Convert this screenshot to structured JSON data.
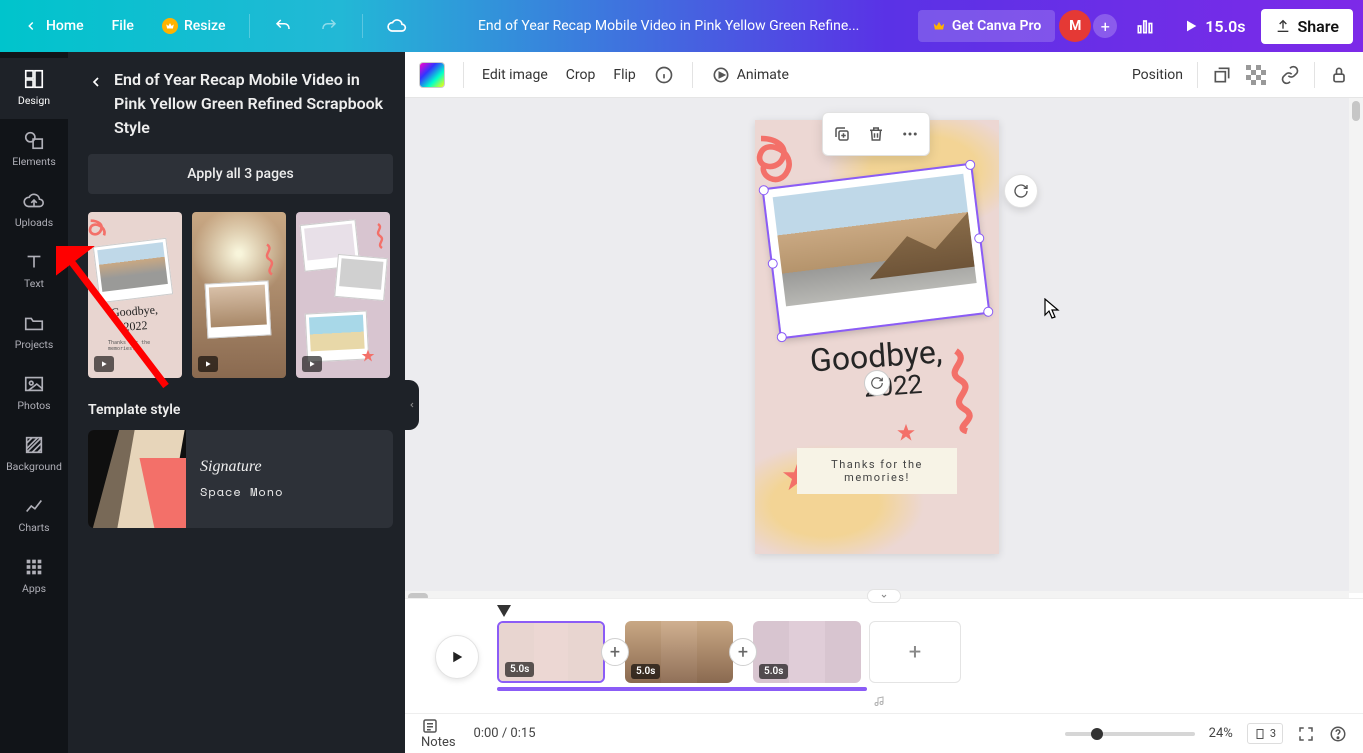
{
  "topbar": {
    "home": "Home",
    "file": "File",
    "resize": "Resize",
    "doc_title": "End of Year Recap Mobile Video in Pink Yellow Green Refine...",
    "get_pro": "Get Canva Pro",
    "avatar_initial": "M",
    "duration": "15.0s",
    "share": "Share"
  },
  "rail": {
    "items": [
      {
        "label": "Design"
      },
      {
        "label": "Elements"
      },
      {
        "label": "Uploads"
      },
      {
        "label": "Text"
      },
      {
        "label": "Projects"
      },
      {
        "label": "Photos"
      },
      {
        "label": "Background"
      },
      {
        "label": "Charts"
      },
      {
        "label": "Apps"
      }
    ]
  },
  "sidepanel": {
    "title": "End of Year Recap Mobile Video in Pink Yellow Green Refined Scrapbook Style",
    "apply": "Apply all 3 pages",
    "template_style": "Template style",
    "style_font1": "Signature",
    "style_font2": "Space Mono"
  },
  "ctxbar": {
    "edit_image": "Edit image",
    "crop": "Crop",
    "flip": "Flip",
    "animate": "Animate",
    "position": "Position"
  },
  "canvas": {
    "headline_1": "Goodbye,",
    "headline_2": "2022",
    "tape_line1": "Thanks for the",
    "tape_line2": "memories!"
  },
  "timeline": {
    "clips": [
      {
        "duration": "5.0s"
      },
      {
        "duration": "5.0s"
      },
      {
        "duration": "5.0s"
      }
    ]
  },
  "bottom": {
    "notes": "Notes",
    "time": "0:00 / 0:15",
    "zoom": "24%",
    "pages": "3"
  }
}
